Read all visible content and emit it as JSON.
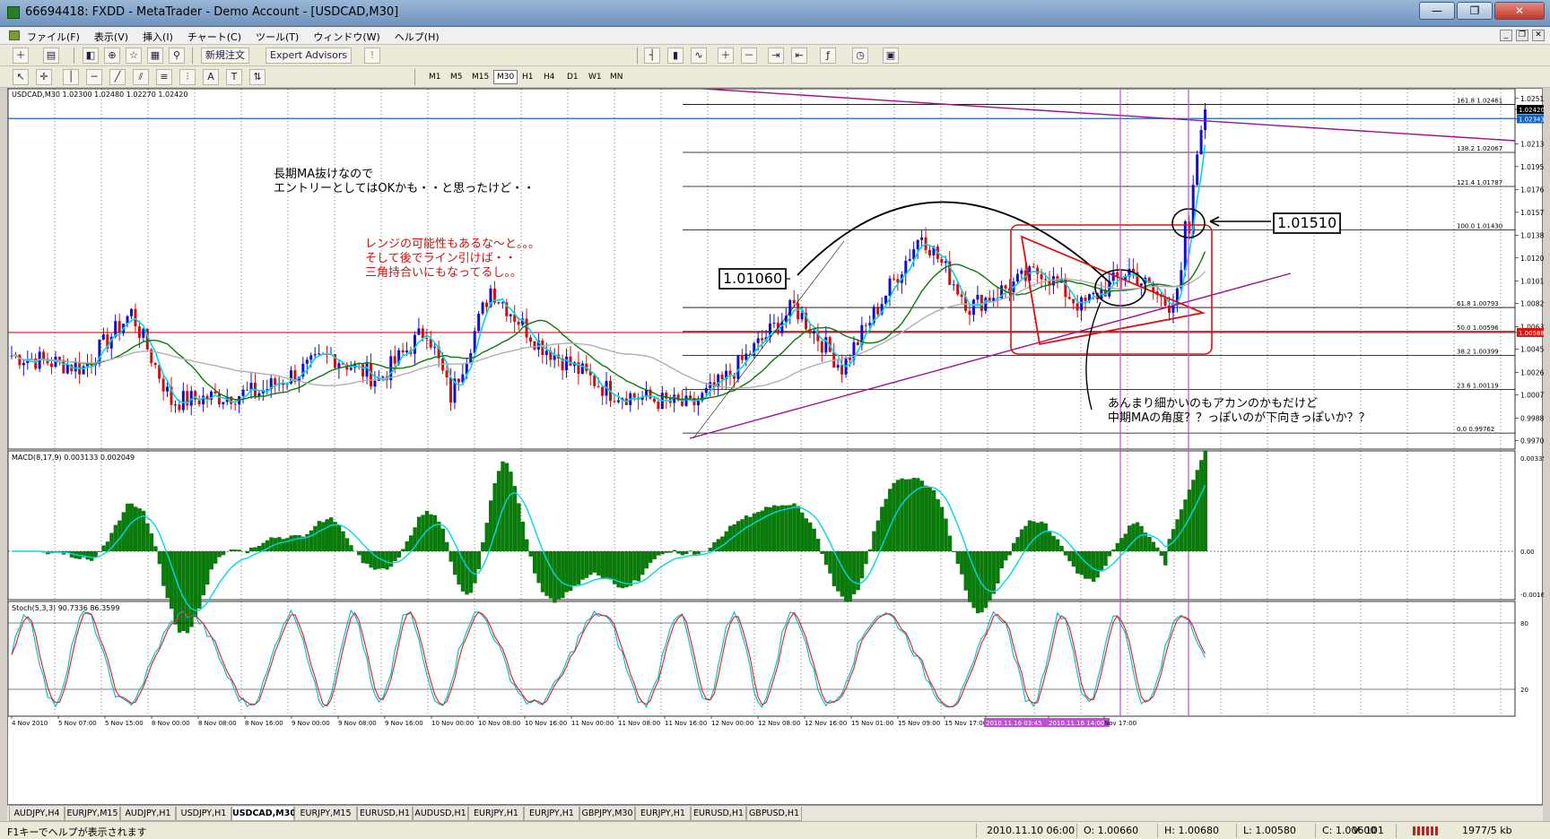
{
  "window": {
    "title": "66694418: FXDD - MetaTrader - Demo Account - [USDCAD,M30]",
    "buttons": {
      "minimize": "—",
      "maximize": "❐",
      "close": "✕"
    }
  },
  "menu": {
    "items": [
      "ファイル(F)",
      "表示(V)",
      "挿入(I)",
      "チャート(C)",
      "ツール(T)",
      "ウィンドウ(W)",
      "ヘルプ(H)"
    ],
    "mdi": [
      "_",
      "❐",
      "✕"
    ]
  },
  "toolbar": {
    "new_order": "新規注文",
    "expert_advisors": "Expert Advisors",
    "timeframes": [
      "M1",
      "M5",
      "M15",
      "M30",
      "H1",
      "H4",
      "D1",
      "W1",
      "MN"
    ],
    "active_timeframe": "M30"
  },
  "chart": {
    "header": "USDCAD,M30  1.02300 1.02480 1.02270 1.02420",
    "macd_header": "MACD(8,17,9) 0.003133 0.002049",
    "stoch_header": "Stoch(5,3,3) 90.7336 86.3599",
    "price_axis": [
      "1.02510",
      "1.02420",
      "1.02343",
      "1.02135",
      "1.01950",
      "1.01760",
      "1.01575",
      "1.01385",
      "1.01200",
      "1.01010",
      "1.00825",
      "1.00635",
      "1.00588",
      "1.00450",
      "1.00260",
      "1.00075",
      "0.99885",
      "0.99700"
    ],
    "macd_axis": [
      "0.003359",
      "0.00",
      "-0.00161"
    ],
    "stoch_axis": [
      "80",
      "20"
    ],
    "fib_levels": [
      {
        "label": "161.8   1.02461"
      },
      {
        "label": "138.2   1.02067"
      },
      {
        "label": "121.4   1.01787"
      },
      {
        "label": "100.0   1.01430"
      },
      {
        "label": "61.8   1.00793"
      },
      {
        "label": "50.0   1.00596"
      },
      {
        "label": "38.2   1.00399"
      },
      {
        "label": "23.6   1.00119"
      },
      {
        "label": "0.0   0.99762"
      }
    ],
    "time_axis": [
      "4 Nov 2010",
      "5 Nov 07:00",
      "5 Nov 15:00",
      "8 Nov 00:00",
      "8 Nov 08:00",
      "8 Nov 16:00",
      "9 Nov 00:00",
      "9 Nov 08:00",
      "9 Nov 16:00",
      "10 Nov 00:00",
      "10 Nov 08:00",
      "10 Nov 16:00",
      "11 Nov 00:00",
      "11 Nov 08:00",
      "11 Nov 16:00",
      "12 Nov 00:00",
      "12 Nov 08:00",
      "12 Nov 16:00",
      "15 Nov 01:00",
      "15 Nov 09:00",
      "15 Nov 17:00",
      "2010.11.16 03:45",
      "2010.11.16 14:00",
      "Nov 17:00"
    ],
    "colors": {
      "candle_up": "#1010cc",
      "candle_down": "#cc1010",
      "fast_ma": "#00d8e8",
      "mid_ma": "#0a7a0a",
      "long_ma": "#b0b0b0",
      "trendline": "#a0108f",
      "support": "#dd1010",
      "macd_hist": "#0a7a0a",
      "macd_signal": "#00d8e8",
      "stoch_main": "#00b8c8",
      "stoch_signal": "#dd2020",
      "vline": "#c04ed6"
    },
    "annotations": {
      "note1": "長期MA抜けなので\nエントリーとしてはOKかも・・と思ったけど・・",
      "note2": "レンジの可能性もあるな～と。。。\nそして後でライン引けば・・\n三角持合いにもなってるし。。",
      "note3": "あんまり細かいのもアカンのかもだけど\n中期MAの角度？？っぽいのが下向きっぽいか？？",
      "box1": "1.01060",
      "box2": "1.01510"
    }
  },
  "tabs": [
    "AUDJPY,H4",
    "EURJPY,M15",
    "AUDJPY,H1",
    "USDJPY,H1",
    "USDCAD,M30",
    "EURJPY,M15",
    "EURUSD,H1",
    "AUDUSD,H1",
    "EURJPY,H1",
    "EURJPY,H1",
    "GBPJPY,M30",
    "EURJPY,H1",
    "EURUSD,H1",
    "GBPUSD,H1"
  ],
  "active_tab": "USDCAD,M30",
  "status": {
    "help": "F1キーでヘルプが表示されます",
    "time": "2010.11.10 06:00",
    "open": "O: 1.00660",
    "high": "H: 1.00680",
    "low": "L: 1.00580",
    "close": "C: 1.00600",
    "volume": "V: 101",
    "traffic": "1977/5 kb"
  }
}
